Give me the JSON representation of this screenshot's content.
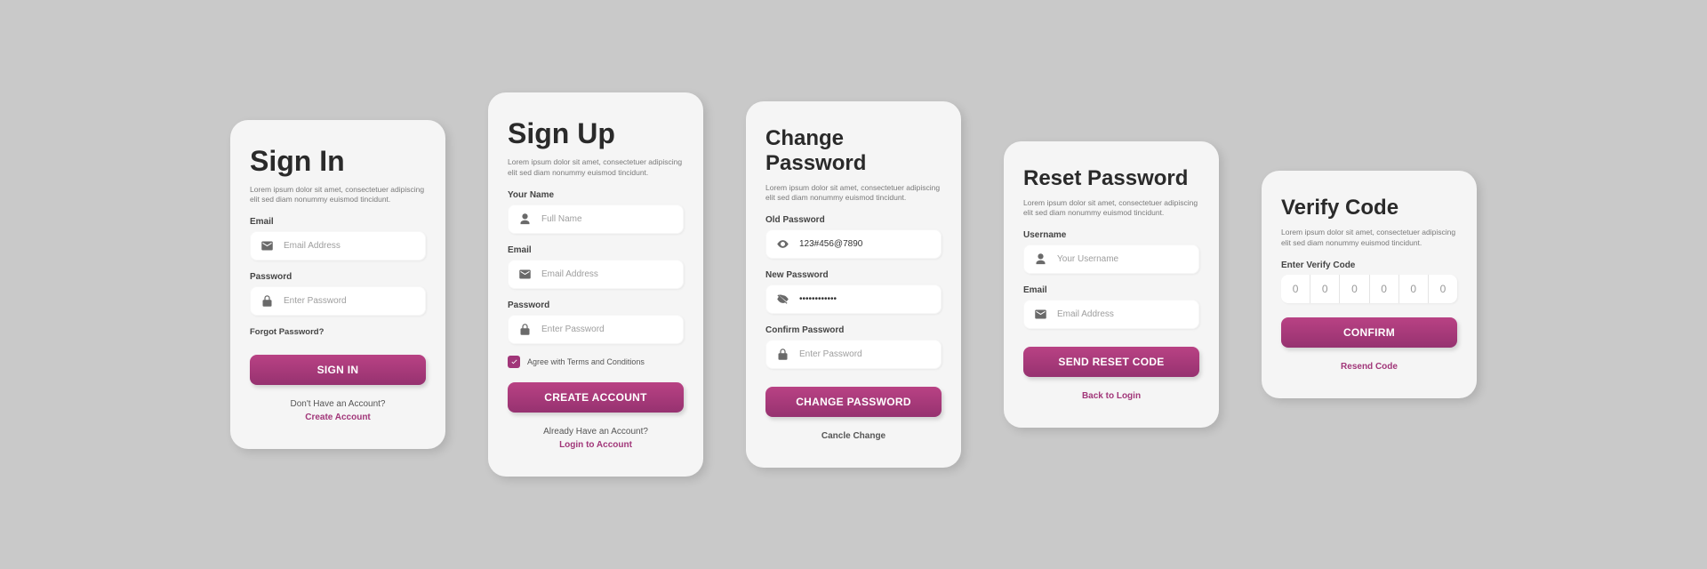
{
  "lorem": "Lorem ipsum dolor sit amet, consectetuer adipiscing elit sed diam nonummy euismod tincidunt.",
  "signin": {
    "title": "Sign In",
    "email_label": "Email",
    "email_placeholder": "Email Address",
    "password_label": "Password",
    "password_placeholder": "Enter Password",
    "forgot": "Forgot Password?",
    "button": "SIGN IN",
    "prompt": "Don't Have an Account?",
    "link": "Create Account"
  },
  "signup": {
    "title": "Sign Up",
    "name_label": "Your Name",
    "name_placeholder": "Full Name",
    "email_label": "Email",
    "email_placeholder": "Email Address",
    "password_label": "Password",
    "password_placeholder": "Enter Password",
    "agree": "Agree with Terms and Conditions",
    "button": "CREATE ACCOUNT",
    "prompt": "Already Have an Account?",
    "link": "Login to Account"
  },
  "change": {
    "title": "Change Password",
    "old_label": "Old Password",
    "old_value": "123#456@7890",
    "new_label": "New Password",
    "new_value": "••••••••••••",
    "confirm_label": "Confirm Password",
    "confirm_placeholder": "Enter Password",
    "button": "CHANGE PASSWORD",
    "cancel": "Cancle Change"
  },
  "reset": {
    "title": "Reset Password",
    "user_label": "Username",
    "user_placeholder": "Your Username",
    "email_label": "Email",
    "email_placeholder": "Email Address",
    "button": "SEND RESET CODE",
    "back": "Back to Login"
  },
  "verify": {
    "title": "Verify Code",
    "code_label": "Enter Verify Code",
    "cells": [
      "0",
      "0",
      "0",
      "0",
      "0",
      "0"
    ],
    "button": "CONFIRM",
    "resend": "Resend Code"
  },
  "colors": {
    "accent": "#a13679"
  }
}
